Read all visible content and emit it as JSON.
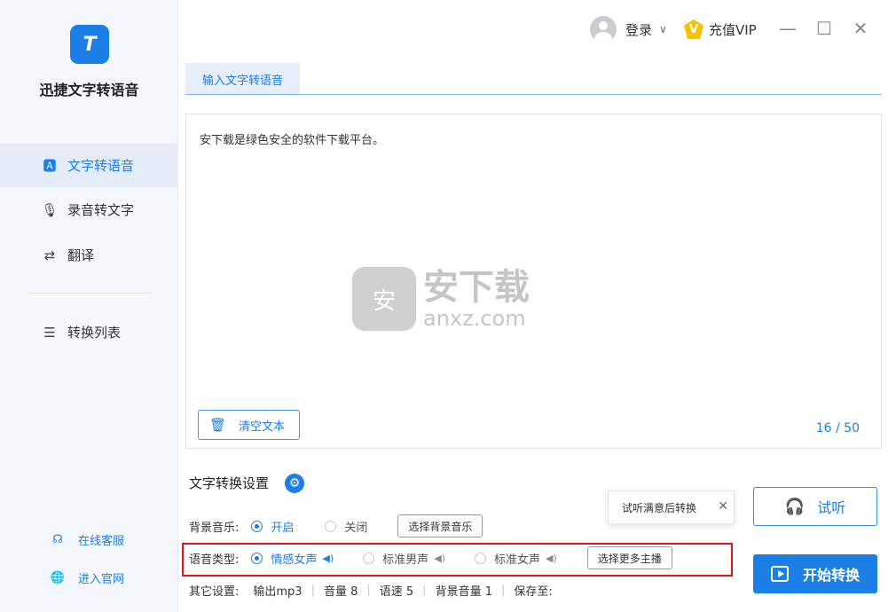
{
  "app": {
    "title": "迅捷文字转语音",
    "logo_glyph": "T"
  },
  "sidebar": {
    "items": [
      {
        "label": "文字转语音",
        "icon": "text-a-icon",
        "active": true
      },
      {
        "label": "录音转文字",
        "icon": "microphone-icon"
      },
      {
        "label": "翻译",
        "icon": "translate-icon"
      },
      {
        "label": "转换列表",
        "icon": "list-icon"
      }
    ],
    "links": [
      {
        "label": "在线客服",
        "icon": "headset-icon"
      },
      {
        "label": "进入官网",
        "icon": "globe-icon"
      }
    ]
  },
  "topbar": {
    "login": "登录",
    "vip": "充值VIP",
    "minimize": "—",
    "maximize": "☐",
    "close": "✕"
  },
  "tabs": [
    {
      "label": "输入文字转语音"
    }
  ],
  "editor": {
    "text": "安下载是绿色安全的软件下载平台。",
    "clear_label": "清空文本",
    "counter": "16 / 50"
  },
  "watermark": {
    "badge": "安",
    "cn": "安下载",
    "en": "anxz.com"
  },
  "settings": {
    "title": "文字转换设置",
    "bgm": {
      "label": "背景音乐:",
      "on": "开启",
      "off": "关闭",
      "selected": "开启",
      "button": "选择背景音乐"
    },
    "voice": {
      "label": "语音类型:",
      "options": [
        "情感女声",
        "标准男声",
        "标准女声"
      ],
      "selected": "情感女声",
      "button": "选择更多主播"
    },
    "other": {
      "label": "其它设置:",
      "items": [
        "输出mp3",
        "音量 8",
        "语速 5",
        "背景音量 1",
        "保存至:"
      ]
    }
  },
  "tooltip": {
    "text": "试听满意后转换",
    "close": "✕"
  },
  "actions": {
    "listen": "试听",
    "start": "开始转换"
  },
  "colors": {
    "accent": "#1a7fe6",
    "highlight_box": "#e5161b",
    "vip": "#f6c200"
  }
}
